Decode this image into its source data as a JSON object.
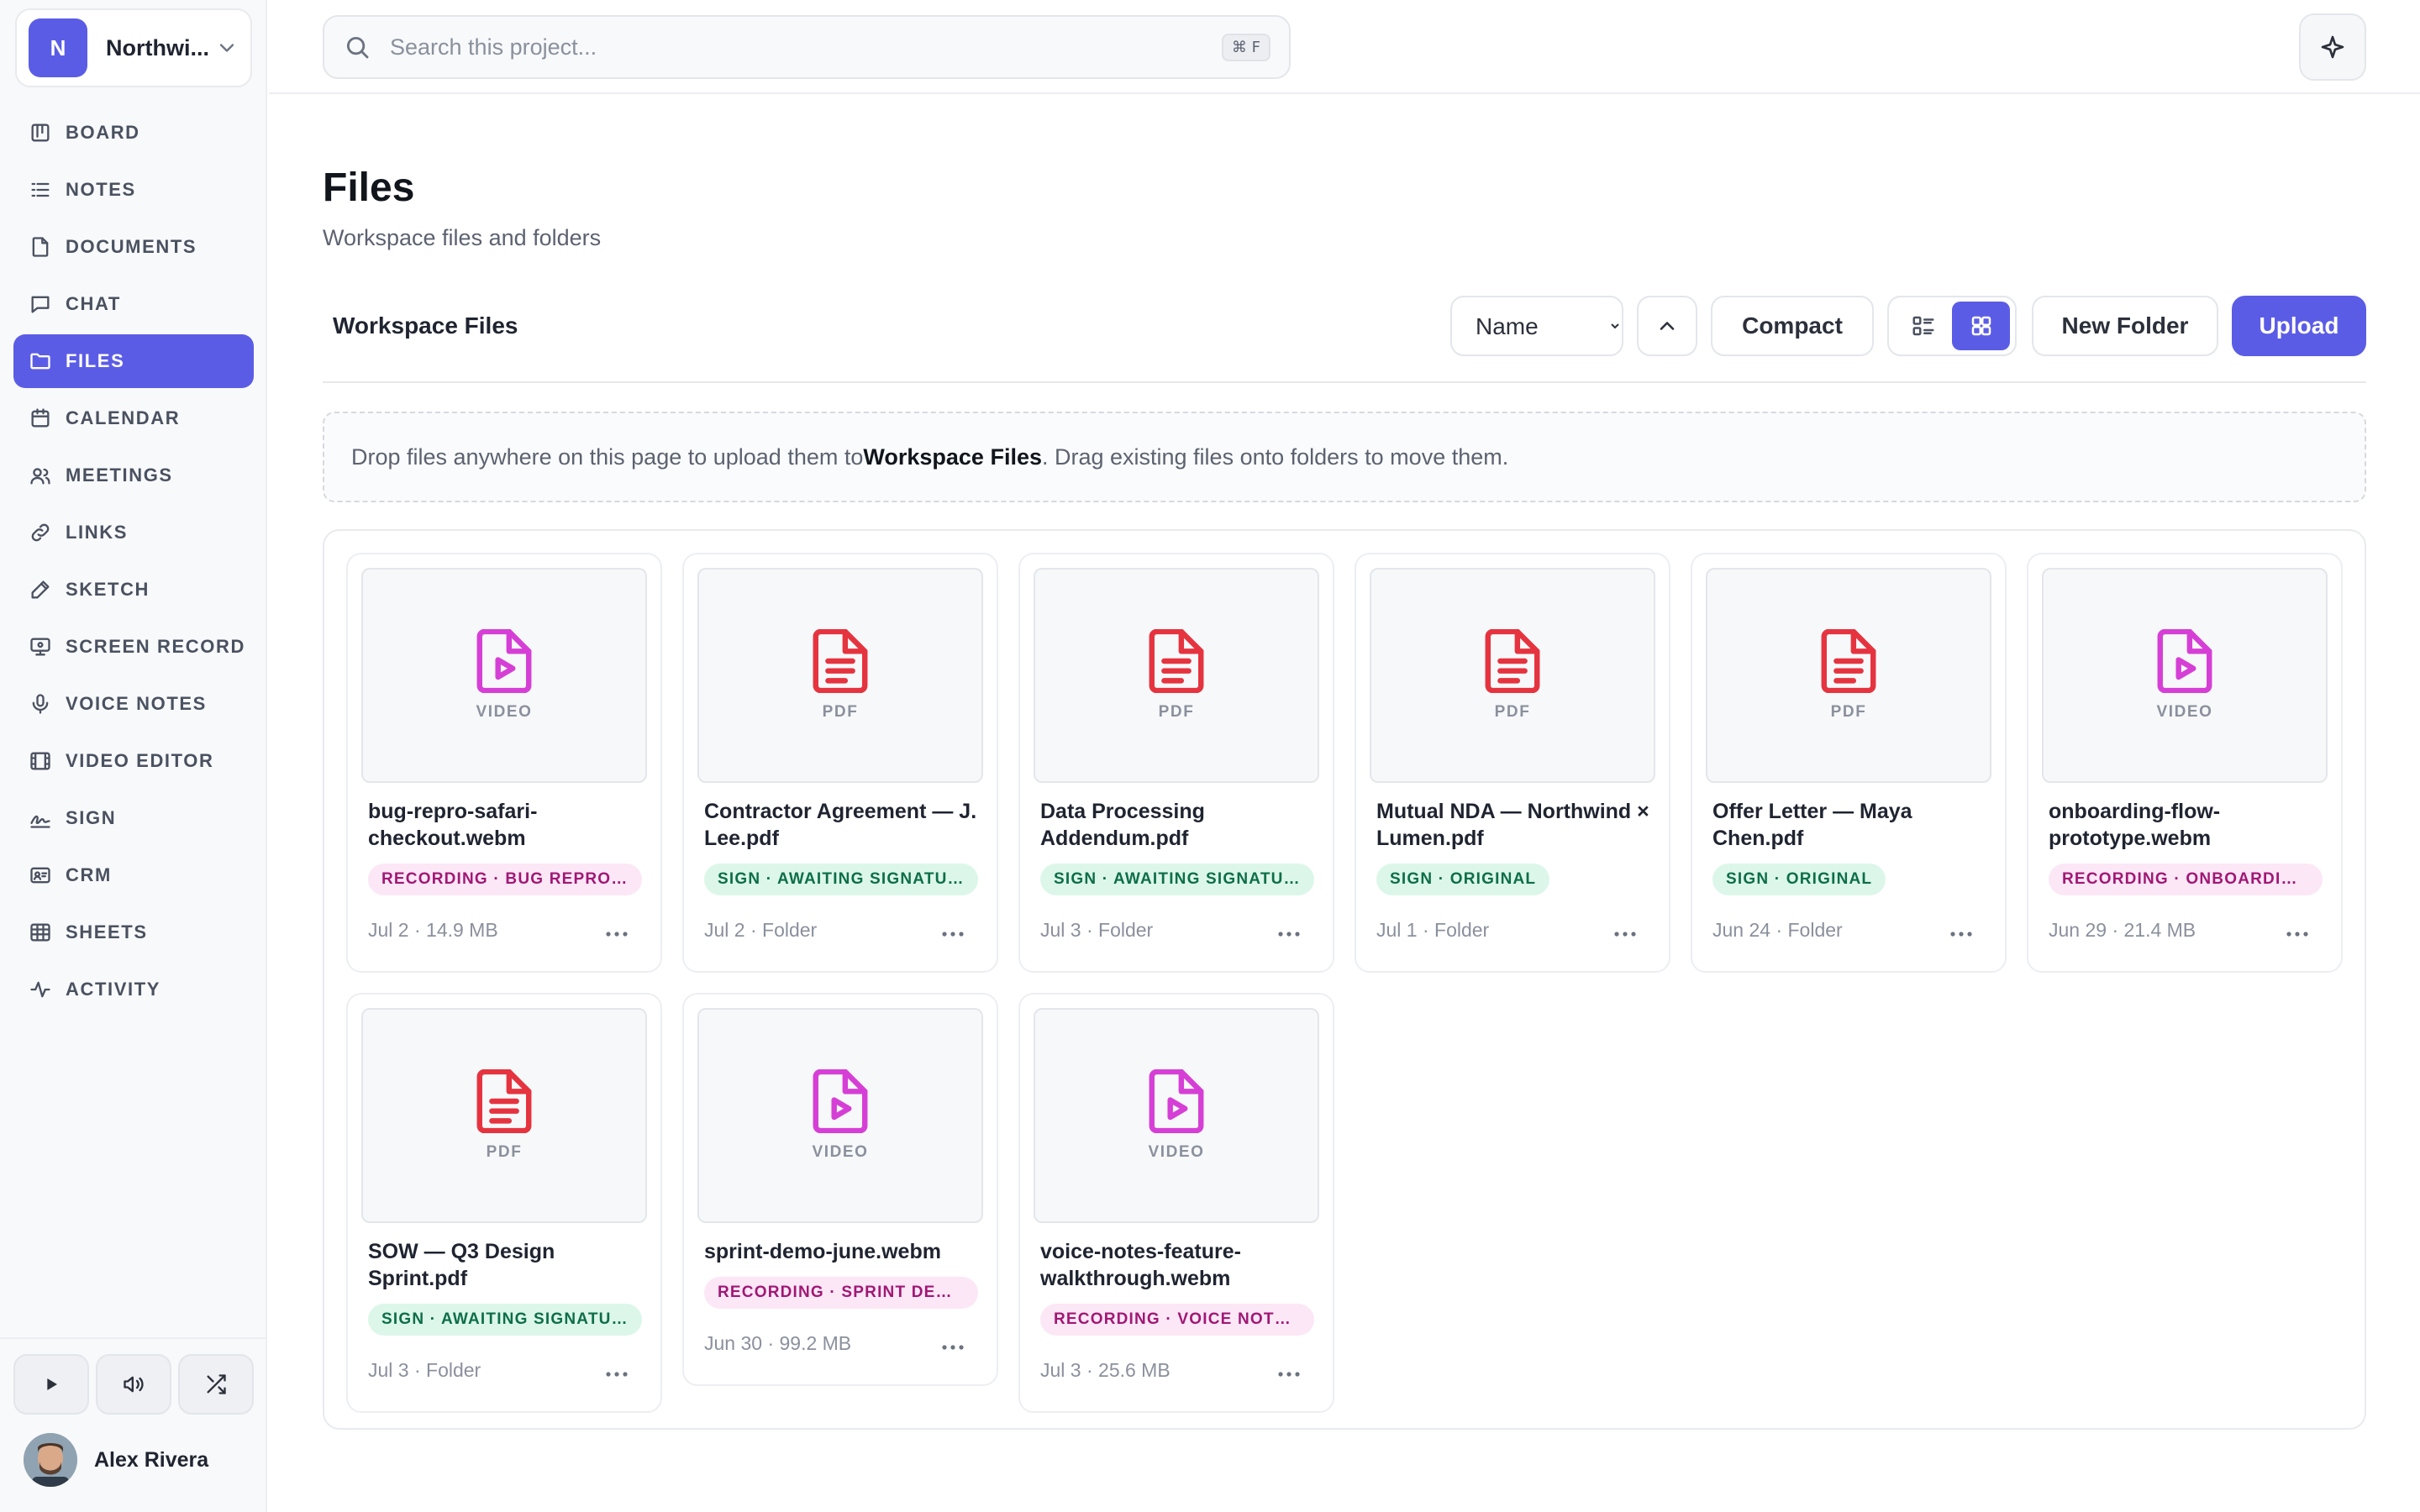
{
  "workspace": {
    "initial": "N",
    "name": "Northwi..."
  },
  "nav": [
    {
      "label": "BOARD",
      "icon": "board-icon",
      "key": "board"
    },
    {
      "label": "NOTES",
      "icon": "notes-icon",
      "key": "notes"
    },
    {
      "label": "DOCUMENTS",
      "icon": "document-icon",
      "key": "documents"
    },
    {
      "label": "CHAT",
      "icon": "chat-icon",
      "key": "chat"
    },
    {
      "label": "FILES",
      "icon": "folder-icon",
      "key": "files",
      "active": true
    },
    {
      "label": "CALENDAR",
      "icon": "calendar-icon",
      "key": "calendar"
    },
    {
      "label": "MEETINGS",
      "icon": "users-icon",
      "key": "meetings"
    },
    {
      "label": "LINKS",
      "icon": "link-icon",
      "key": "links"
    },
    {
      "label": "SKETCH",
      "icon": "pencil-icon",
      "key": "sketch"
    },
    {
      "label": "SCREEN RECORD",
      "icon": "monitor-icon",
      "key": "screen-record"
    },
    {
      "label": "VOICE NOTES",
      "icon": "microphone-icon",
      "key": "voice-notes"
    },
    {
      "label": "VIDEO EDITOR",
      "icon": "film-icon",
      "key": "video-editor"
    },
    {
      "label": "SIGN",
      "icon": "signature-icon",
      "key": "sign"
    },
    {
      "label": "CRM",
      "icon": "contact-card-icon",
      "key": "crm"
    },
    {
      "label": "SHEETS",
      "icon": "table-icon",
      "key": "sheets"
    },
    {
      "label": "ACTIVITY",
      "icon": "activity-icon",
      "key": "activity"
    }
  ],
  "user": {
    "name": "Alex Rivera"
  },
  "search": {
    "placeholder": "Search this project...",
    "shortcut": "⌘ F"
  },
  "page": {
    "title": "Files",
    "subtitle": "Workspace files and folders"
  },
  "toolbar": {
    "label": "Workspace Files",
    "sort_selected": "Name",
    "compact_label": "Compact",
    "new_folder_label": "New Folder",
    "upload_label": "Upload"
  },
  "dropzone": {
    "before": "Drop files anywhere on this page to upload them to ",
    "target": "Workspace Files",
    "after": ". Drag existing files onto folders to move them."
  },
  "colors": {
    "accent": "#5b5ce6",
    "video": "#d63fd6",
    "pdf": "#e5343f",
    "recording_bg": "#fce7f6",
    "sign_bg": "#dcf7ea"
  },
  "files": [
    {
      "name": "bug-repro-safari-checkout.webm",
      "type": "VIDEO",
      "tag": "RECORDING · BUG REPRO —...",
      "tag_kind": "recording",
      "meta": "Jul 2 · 14.9 MB"
    },
    {
      "name": "Contractor Agreement — J. Lee.pdf",
      "type": "PDF",
      "tag": "SIGN · AWAITING SIGNATUR...",
      "tag_kind": "sign",
      "meta": "Jul 2 · Folder"
    },
    {
      "name": "Data Processing Addendum.pdf",
      "type": "PDF",
      "tag": "SIGN · AWAITING SIGNATUR...",
      "tag_kind": "sign",
      "meta": "Jul 3 · Folder"
    },
    {
      "name": "Mutual NDA — Northwind × Lumen.pdf",
      "type": "PDF",
      "tag": "SIGN · ORIGINAL",
      "tag_kind": "sign",
      "meta": "Jul 1 · Folder"
    },
    {
      "name": "Offer Letter — Maya Chen.pdf",
      "type": "PDF",
      "tag": "SIGN · ORIGINAL",
      "tag_kind": "sign",
      "meta": "Jun 24 · Folder"
    },
    {
      "name": "onboarding-flow-prototype.webm",
      "type": "VIDEO",
      "tag": "RECORDING · ONBOARDING...",
      "tag_kind": "recording",
      "meta": "Jun 29 · 21.4 MB"
    },
    {
      "name": "SOW — Q3 Design Sprint.pdf",
      "type": "PDF",
      "tag": "SIGN · AWAITING SIGNATUR...",
      "tag_kind": "sign",
      "meta": "Jul 3 · Folder"
    },
    {
      "name": "sprint-demo-june.webm",
      "type": "VIDEO",
      "tag": "RECORDING · SPRINT DEMO...",
      "tag_kind": "recording",
      "meta": "Jun 30 · 99.2 MB"
    },
    {
      "name": "voice-notes-feature-walkthrough.webm",
      "type": "VIDEO",
      "tag": "RECORDING · VOICE NOTES...",
      "tag_kind": "recording",
      "meta": "Jul 3 · 25.6 MB"
    }
  ]
}
